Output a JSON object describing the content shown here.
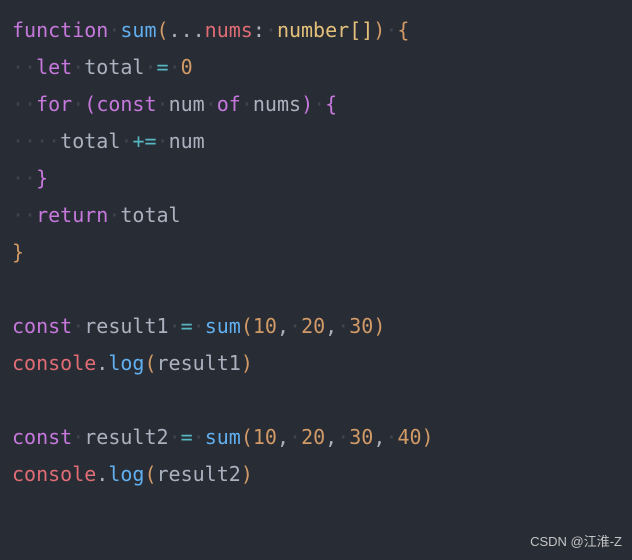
{
  "code": {
    "l1": {
      "kw": "function",
      "sp1": "·",
      "fn": "sum",
      "paren1": "(",
      "spread": "...",
      "param": "nums",
      "colon": ":",
      "sp2": "·",
      "type": "number",
      "arr": "[]",
      "paren2": ")",
      "sp3": "·",
      "brace": "{"
    },
    "l2": {
      "indent": "··",
      "kw": "let",
      "sp1": "·",
      "var": "total",
      "sp2": "·",
      "eq": "=",
      "sp3": "·",
      "num": "0"
    },
    "l3": {
      "indent": "··",
      "kw": "for",
      "sp1": "·",
      "paren1": "(",
      "const": "const",
      "sp2": "·",
      "var": "num",
      "sp3": "·",
      "of": "of",
      "sp4": "·",
      "iter": "nums",
      "paren2": ")",
      "sp5": "·",
      "brace": "{"
    },
    "l4": {
      "indent": "····",
      "var": "total",
      "sp1": "·",
      "op": "+=",
      "sp2": "·",
      "val": "num"
    },
    "l5": {
      "indent": "··",
      "brace": "}"
    },
    "l6": {
      "indent": "··",
      "kw": "return",
      "sp1": "·",
      "var": "total"
    },
    "l7": {
      "brace": "}"
    },
    "l8": {
      "empty": ""
    },
    "l9": {
      "const": "const",
      "sp1": "·",
      "var": "result1",
      "sp2": "·",
      "eq": "=",
      "sp3": "·",
      "fn": "sum",
      "paren1": "(",
      "n1": "10",
      "c1": ",",
      "sp4": "·",
      "n2": "20",
      "c2": ",",
      "sp5": "·",
      "n3": "30",
      "paren2": ")"
    },
    "l10": {
      "obj": "console",
      "dot": ".",
      "method": "log",
      "paren1": "(",
      "arg": "result1",
      "paren2": ")"
    },
    "l11": {
      "empty": ""
    },
    "l12": {
      "const": "const",
      "sp1": "·",
      "var": "result2",
      "sp2": "·",
      "eq": "=",
      "sp3": "·",
      "fn": "sum",
      "paren1": "(",
      "n1": "10",
      "c1": ",",
      "sp4": "·",
      "n2": "20",
      "c2": ",",
      "sp5": "·",
      "n3": "30",
      "c3": ",",
      "sp6": "·",
      "n4": "40",
      "paren2": ")"
    },
    "l13": {
      "obj": "console",
      "dot": ".",
      "method": "log",
      "paren1": "(",
      "arg": "result2",
      "paren2": ")"
    }
  },
  "watermark": "CSDN @江淮-Z"
}
